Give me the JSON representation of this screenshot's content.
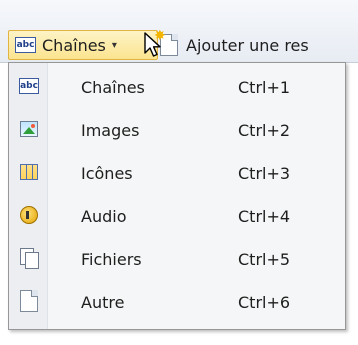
{
  "toolbar": {
    "dropdown": {
      "icon_text": "abc",
      "label": "Chaînes",
      "caret": "▾"
    },
    "add_resource": {
      "label": "Ajouter une res"
    }
  },
  "menu": {
    "items": [
      {
        "icon": "abc-icon",
        "icon_text": "abc",
        "label": "Chaînes",
        "shortcut": "Ctrl+1"
      },
      {
        "icon": "image-icon",
        "label": "Images",
        "shortcut": "Ctrl+2"
      },
      {
        "icon": "icons-grid-icon",
        "label": "Icônes",
        "shortcut": "Ctrl+3"
      },
      {
        "icon": "audio-icon",
        "label": "Audio",
        "shortcut": "Ctrl+4"
      },
      {
        "icon": "files-icon",
        "label": "Fichiers",
        "shortcut": "Ctrl+5"
      },
      {
        "icon": "document-icon",
        "label": "Autre",
        "shortcut": "Ctrl+6"
      }
    ]
  },
  "colors": {
    "button_highlight": "#fbe48f",
    "button_border": "#e2b33f",
    "menu_background": "#f5f6f7"
  }
}
